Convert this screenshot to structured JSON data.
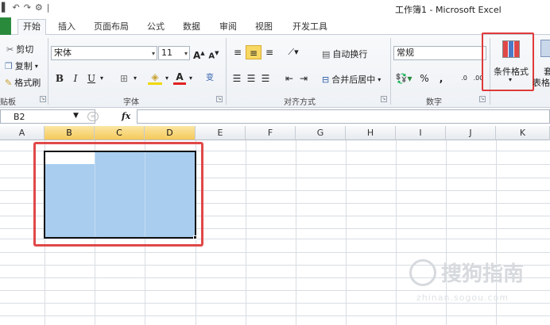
{
  "window": {
    "title": "工作簿1 - Microsoft Excel"
  },
  "qat": {
    "undo": "↶",
    "redo": "↷",
    "sep": "|"
  },
  "tabs": [
    {
      "label": "开始",
      "active": true
    },
    {
      "label": "插入"
    },
    {
      "label": "页面布局"
    },
    {
      "label": "公式"
    },
    {
      "label": "数据"
    },
    {
      "label": "审阅"
    },
    {
      "label": "视图"
    },
    {
      "label": "开发工具"
    }
  ],
  "ribbon": {
    "clipboard": {
      "cut": "剪切",
      "copy": "复制",
      "format_painter": "格式刷",
      "group": "贴板"
    },
    "font": {
      "name": "宋体",
      "size": "11",
      "group": "字体",
      "bold": "B",
      "italic": "I",
      "underline": "U",
      "grow": "A",
      "shrink": "A",
      "wen": "变"
    },
    "alignment": {
      "wrap": "自动换行",
      "merge": "合并后居中",
      "group": "对齐方式"
    },
    "number": {
      "format": "常规",
      "percent": "%",
      "comma": ",",
      "group": "数字"
    },
    "styles": {
      "conditional_format": "条件格式",
      "table_format_line1": "套",
      "table_format_line2": "表格"
    }
  },
  "formula": {
    "name_box": "B2",
    "fx": "fx"
  },
  "columns": [
    "A",
    "B",
    "C",
    "D",
    "E",
    "F",
    "G",
    "H",
    "I",
    "J",
    "K"
  ],
  "selected_columns": [
    "B",
    "C",
    "D"
  ],
  "watermark": {
    "text": "搜狗指南",
    "url": "zhinan.sogou.com"
  },
  "colors": {
    "selection": "#a9cdee",
    "highlight_border": "#e04848",
    "excel_green": "#2a8a3c"
  }
}
